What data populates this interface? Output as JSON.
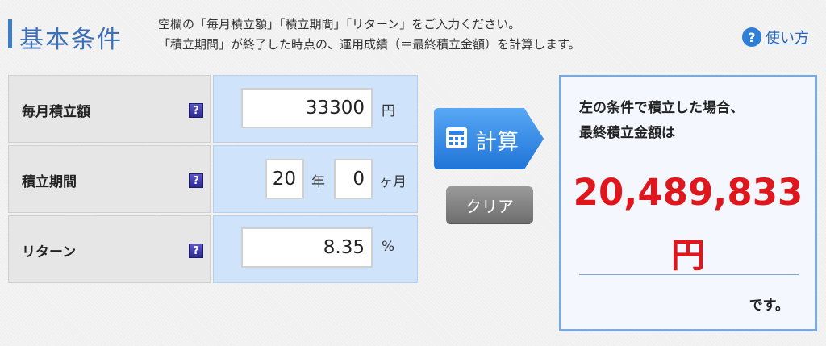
{
  "header": {
    "title": "基本条件",
    "desc_line1": "空欄の「毎月積立額」「積立期間」「リターン」をご入力ください。",
    "desc_line2": "「積立期間」が終了した時点の、運用成績（＝最終積立金額）を計算します。",
    "help_label": "使い方",
    "help_icon": "question-circle-icon"
  },
  "form": {
    "monthly": {
      "label": "毎月積立額",
      "value": "33300",
      "unit": "円"
    },
    "period": {
      "label": "積立期間",
      "years_value": "20",
      "years_unit": "年",
      "months_value": "0",
      "months_unit": "ヶ月"
    },
    "return": {
      "label": "リターン",
      "value": "8.35",
      "unit": "%"
    },
    "help_glyph": "?"
  },
  "buttons": {
    "calculate": "計算",
    "clear": "クリア"
  },
  "result": {
    "line1": "左の条件で積立した場合、",
    "line2": "最終積立金額は",
    "amount": "20,489,833",
    "amount_unit": "円",
    "suffix": "です。"
  },
  "colors": {
    "accent": "#3d7cc9",
    "result_red": "#e0161d",
    "input_bg": "#cfe3fb",
    "calc_blue": "#2a83e8"
  }
}
